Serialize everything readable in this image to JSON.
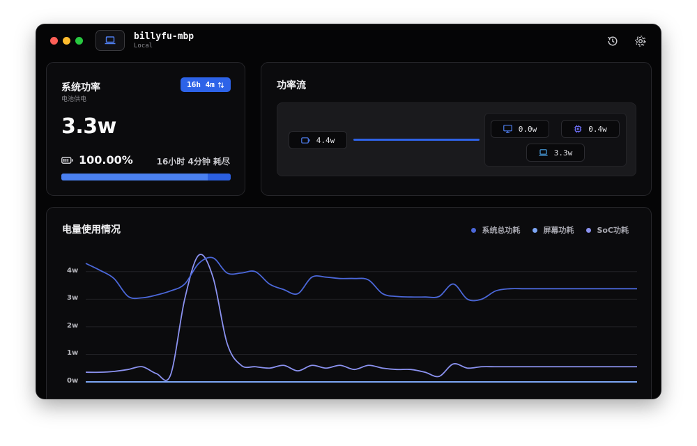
{
  "window": {
    "host": "billyfu-mbp",
    "host_sub": "Local"
  },
  "icons": {
    "device": "laptop-icon",
    "history": "history-icon",
    "settings": "gear-icon"
  },
  "system_power": {
    "title": "系统功率",
    "subtitle": "电池供电",
    "time_badge": "16h 4m",
    "value": "3.3w",
    "battery_percent": "100.00%",
    "remaining": "16小时 4分钟 耗尽",
    "charge_level": 0.865
  },
  "power_flow": {
    "title": "功率流",
    "source": "4.4w",
    "screen": "0.0w",
    "soc": "0.4w",
    "laptop": "3.3w"
  },
  "usage": {
    "title": "电量使用情况",
    "legend": [
      "系统总功耗",
      "屏幕功耗",
      "SoC功耗"
    ]
  },
  "colors": {
    "accent": "#2d63e8",
    "system_total": "#4b67d8",
    "screen": "#7da6f5",
    "soc": "#8b92f0"
  },
  "chart_data": {
    "type": "line",
    "yticks": [
      "4w",
      "3w",
      "2w",
      "1w",
      "0w"
    ],
    "ylim": [
      0,
      4.5
    ],
    "x": [
      0,
      1,
      2,
      3,
      4,
      5,
      6,
      7,
      8,
      9,
      10,
      11,
      12,
      13,
      14,
      15,
      16,
      17,
      18,
      19,
      20,
      21,
      22,
      23,
      24,
      25,
      26,
      27,
      28,
      29,
      30,
      31,
      32,
      33,
      34,
      35,
      36,
      37,
      38,
      39
    ],
    "series": [
      {
        "name": "系统总功耗",
        "values": [
          4.3,
          4.05,
          3.75,
          3.1,
          3.05,
          3.15,
          3.3,
          3.55,
          4.3,
          4.5,
          3.95,
          3.95,
          4.0,
          3.55,
          3.35,
          3.2,
          3.8,
          3.8,
          3.75,
          3.75,
          3.7,
          3.2,
          3.1,
          3.08,
          3.08,
          3.1,
          3.55,
          3.0,
          3.0,
          3.3,
          3.38,
          3.38,
          3.38,
          3.38,
          3.38,
          3.38,
          3.38,
          3.38,
          3.38,
          3.38
        ]
      },
      {
        "name": "屏幕功耗",
        "values": [
          0.0,
          0.0,
          0.0,
          0.0,
          0.0,
          0.0,
          0.0,
          0.0,
          0.0,
          0.0,
          0.0,
          0.0,
          0.0,
          0.0,
          0.0,
          0.0,
          0.0,
          0.0,
          0.0,
          0.0,
          0.0,
          0.0,
          0.0,
          0.0,
          0.0,
          0.0,
          0.0,
          0.0,
          0.0,
          0.0,
          0.0,
          0.0,
          0.0,
          0.0,
          0.0,
          0.0,
          0.0,
          0.0,
          0.0,
          0.0
        ]
      },
      {
        "name": "SoC功耗",
        "values": [
          0.35,
          0.35,
          0.38,
          0.45,
          0.55,
          0.3,
          0.25,
          3.0,
          4.6,
          3.8,
          1.4,
          0.6,
          0.55,
          0.5,
          0.6,
          0.4,
          0.6,
          0.5,
          0.6,
          0.45,
          0.6,
          0.5,
          0.45,
          0.45,
          0.35,
          0.2,
          0.65,
          0.5,
          0.55,
          0.55,
          0.55,
          0.55,
          0.55,
          0.55,
          0.55,
          0.55,
          0.55,
          0.55,
          0.55,
          0.55
        ]
      }
    ]
  }
}
